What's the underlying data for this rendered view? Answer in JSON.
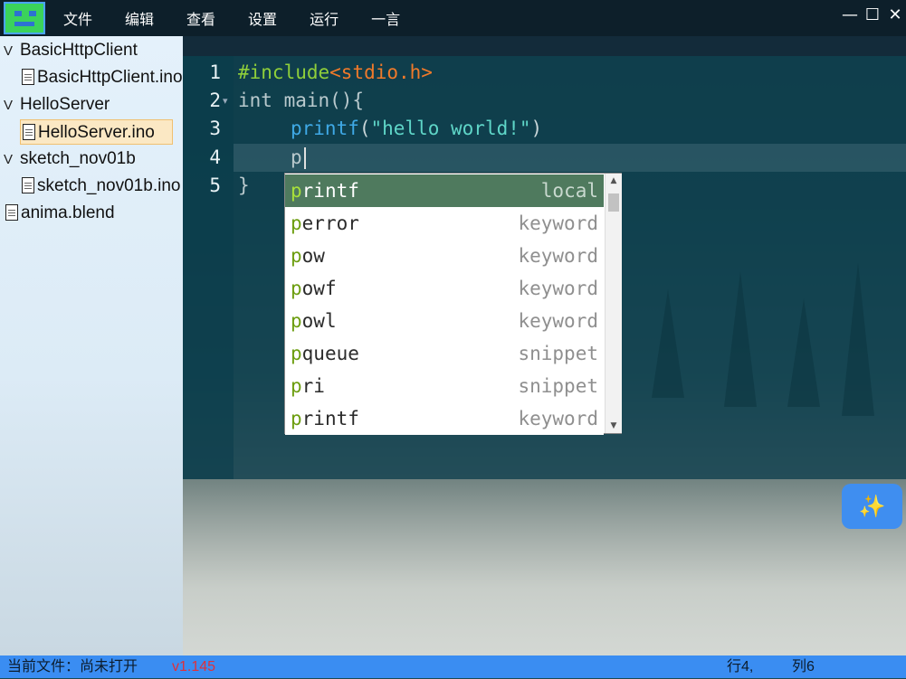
{
  "menu": [
    "文件",
    "编辑",
    "查看",
    "设置",
    "运行",
    "一言"
  ],
  "window_controls": {
    "minimize": "—",
    "maximize": "☐",
    "close": "✕"
  },
  "file_tree": [
    {
      "label": "BasicHttpClient",
      "type": "folder",
      "twisty": "V"
    },
    {
      "label": "BasicHttpClient.ino",
      "type": "file"
    },
    {
      "label": "HelloServer",
      "type": "folder",
      "twisty": "V"
    },
    {
      "label": "HelloServer.ino",
      "type": "file",
      "selected": true
    },
    {
      "label": "sketch_nov01b",
      "type": "folder",
      "twisty": "V"
    },
    {
      "label": "sketch_nov01b.ino",
      "type": "file"
    },
    {
      "label": "anima.blend",
      "type": "file"
    }
  ],
  "editor": {
    "line_numbers": [
      "1",
      "2",
      "3",
      "4",
      "5"
    ],
    "lines": {
      "l1_directive": "#include",
      "l1_header": "<stdio.h>",
      "l2": "int main(){",
      "l3_fn": "printf",
      "l3_open": "(",
      "l3_str": "\"hello world!\"",
      "l3_close": ")",
      "l4": "p",
      "l5": "}"
    }
  },
  "autocomplete": {
    "typed": "p",
    "items": [
      {
        "label": "printf",
        "kind": "local"
      },
      {
        "label": "perror",
        "kind": "keyword"
      },
      {
        "label": "pow",
        "kind": "keyword"
      },
      {
        "label": "powf",
        "kind": "keyword"
      },
      {
        "label": "powl",
        "kind": "keyword"
      },
      {
        "label": "pqueue",
        "kind": "snippet"
      },
      {
        "label": "pri",
        "kind": "snippet"
      },
      {
        "label": "printf",
        "kind": "keyword"
      }
    ]
  },
  "fab": {
    "icon": "sparkle-icon",
    "glyph": "✨"
  },
  "status": {
    "current_file": "当前文件：尚未打开",
    "version": "v1.145",
    "row": "行4,",
    "col": "列6"
  },
  "colors": {
    "titlebar": "#0d1f2a",
    "status_bar": "#3a8df2",
    "version_text": "#e0303a",
    "keyword_blue": "#3fa9e6",
    "string_teal": "#5fd6c8",
    "include_green": "#8fcf3a",
    "header_orange": "#f07a2a",
    "ac_active": "#4f7a5e",
    "ac_match": "#6c9d0f"
  }
}
